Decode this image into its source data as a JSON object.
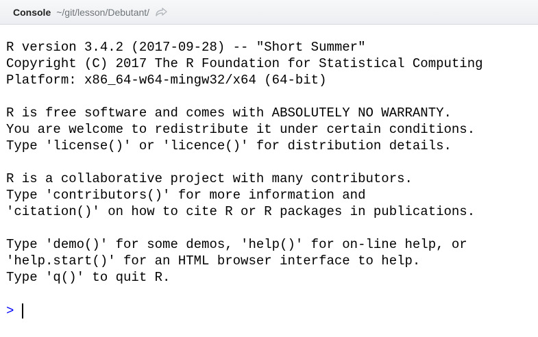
{
  "header": {
    "tab_label": "Console",
    "working_dir": "~/git/lesson/Debutant/",
    "nav_icon": "go-to-directory-icon"
  },
  "console": {
    "lines": [
      "R version 3.4.2 (2017-09-28) -- \"Short Summer\"",
      "Copyright (C) 2017 The R Foundation for Statistical Computing",
      "Platform: x86_64-w64-mingw32/x64 (64-bit)",
      "",
      "R is free software and comes with ABSOLUTELY NO WARRANTY.",
      "You are welcome to redistribute it under certain conditions.",
      "Type 'license()' or 'licence()' for distribution details.",
      "",
      "R is a collaborative project with many contributors.",
      "Type 'contributors()' for more information and",
      "'citation()' on how to cite R or R packages in publications.",
      "",
      "Type 'demo()' for some demos, 'help()' for on-line help, or",
      "'help.start()' for an HTML browser interface to help.",
      "Type 'q()' to quit R."
    ],
    "prompt": ">",
    "input_value": ""
  },
  "colors": {
    "prompt": "#0000ff",
    "text": "#000000",
    "path": "#6f7479"
  }
}
